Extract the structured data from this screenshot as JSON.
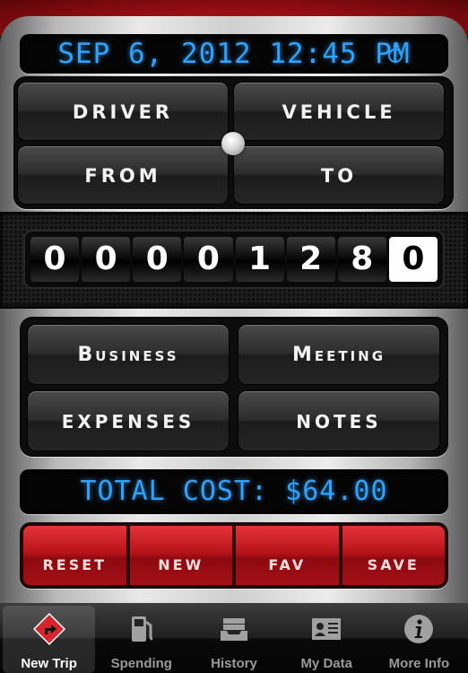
{
  "header": {
    "datetime": "SEP 6, 2012 12:45 PM",
    "timer_icon": "stopwatch-icon"
  },
  "trip_buttons": {
    "driver": "DRIVER",
    "vehicle": "VEHICLE",
    "from": "FROM",
    "to": "TO"
  },
  "odometer": {
    "digits": [
      "0",
      "0",
      "0",
      "0",
      "1",
      "2",
      "8",
      "0"
    ]
  },
  "detail_buttons": {
    "business": "Business",
    "meeting": "Meeting",
    "expenses": "EXPENSES",
    "notes": "NOTES"
  },
  "total": {
    "text": "TOTAL COST: $64.00"
  },
  "actions": {
    "reset": "RESET",
    "new": "NEW",
    "fav": "FAV",
    "save": "SAVE"
  },
  "tabbar": {
    "items": [
      {
        "label": "New Trip",
        "icon": "route-arrow-icon",
        "active": true
      },
      {
        "label": "Spending",
        "icon": "fuel-pump-icon",
        "active": false
      },
      {
        "label": "History",
        "icon": "inbox-tray-icon",
        "active": false
      },
      {
        "label": "My Data",
        "icon": "id-card-icon",
        "active": false
      },
      {
        "label": "More Info",
        "icon": "info-icon",
        "active": false
      }
    ]
  },
  "colors": {
    "lcd_text": "#2da3ff",
    "accent_red": "#b8141b",
    "leather_red": "#8e0d12"
  }
}
